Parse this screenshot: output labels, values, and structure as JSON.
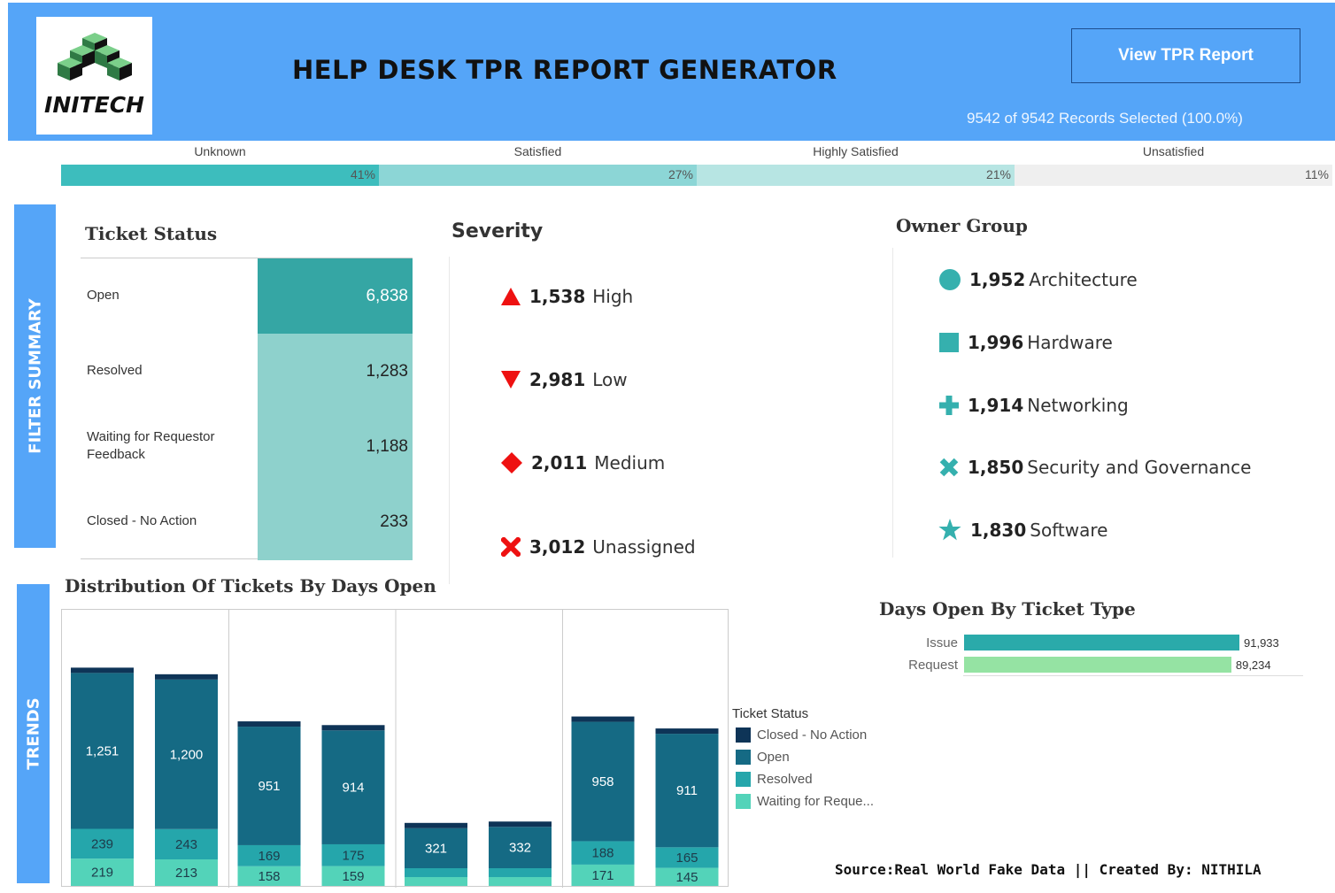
{
  "header": {
    "logo_text": "INITECH",
    "title": "HELP DESK TPR REPORT GENERATOR",
    "button_label": "View TPR Report",
    "records_text": "9542 of 9542 Records Selected (100.0%)",
    "background": "#55a5f8"
  },
  "satisfaction": [
    {
      "label": "Unknown",
      "pct": "41%",
      "color": "#3dbdbd"
    },
    {
      "label": "Satisfied",
      "pct": "27%",
      "color": "#8cd6d6"
    },
    {
      "label": "Highly Satisfied",
      "pct": "21%",
      "color": "#b7e5e3"
    },
    {
      "label": "Unsatisfied",
      "pct": "11%",
      "color": "#efefef"
    }
  ],
  "sidebar_tabs": {
    "filter_summary": "FILTER SUMMARY",
    "trends": "TRENDS"
  },
  "ticket_status": {
    "title": "Ticket Status",
    "rows": [
      {
        "label": "Open",
        "value": "6,838",
        "color": "#35a6a4"
      },
      {
        "label": "Resolved",
        "value": "1,283",
        "color": "#8ed1cc"
      },
      {
        "label": "Waiting for Requestor Feedback",
        "value": "1,188",
        "color": "#8ed1cc"
      },
      {
        "label": "Closed - No Action",
        "value": "233",
        "color": "#8ed1cc"
      }
    ]
  },
  "severity": {
    "title": "Severity",
    "items": [
      {
        "icon": "triangle-up-icon",
        "value": "1,538",
        "label": "High"
      },
      {
        "icon": "triangle-down-icon",
        "value": "2,981",
        "label": "Low"
      },
      {
        "icon": "diamond-icon",
        "value": "2,011",
        "label": "Medium"
      },
      {
        "icon": "x-icon",
        "value": "3,012",
        "label": "Unassigned"
      }
    ],
    "icon_color": "#ee1111"
  },
  "owner_group": {
    "title": "Owner Group",
    "items": [
      {
        "icon": "circle-icon",
        "value": "1,952",
        "label": "Architecture"
      },
      {
        "icon": "square-icon",
        "value": "1,996",
        "label": "Hardware"
      },
      {
        "icon": "plus-icon",
        "value": "1,914",
        "label": "Networking"
      },
      {
        "icon": "x-icon",
        "value": "1,850",
        "label": "Security and Governance"
      },
      {
        "icon": "star-icon",
        "value": "1,830",
        "label": "Software"
      }
    ],
    "icon_color": "#35b0ae"
  },
  "distribution": {
    "title": "Distribution Of Tickets By Days Open",
    "legend_title": "Ticket Status",
    "legend": [
      {
        "label": "Closed - No Action",
        "color": "#0e3457"
      },
      {
        "label": "Open",
        "color": "#156a84"
      },
      {
        "label": "Resolved",
        "color": "#25a6ab"
      },
      {
        "label": "Waiting for Reque...",
        "color": "#53d3b9"
      }
    ]
  },
  "chart_data": {
    "type": "bar",
    "stacked": true,
    "series": [
      {
        "name": "Closed - No Action",
        "values": [
          null,
          null,
          null,
          null,
          null,
          null,
          null,
          null
        ]
      },
      {
        "name": "Open",
        "values": [
          1251,
          1200,
          951,
          914,
          321,
          332,
          958,
          911
        ]
      },
      {
        "name": "Resolved",
        "values": [
          239,
          243,
          169,
          175,
          null,
          null,
          188,
          165
        ]
      },
      {
        "name": "Waiting for Reque...",
        "values": [
          219,
          213,
          158,
          159,
          null,
          null,
          171,
          145
        ]
      }
    ],
    "groups": 4,
    "bars_per_group": 2,
    "grid": false
  },
  "days_open_by_type": {
    "title": "Days Open By Ticket Type",
    "items": [
      {
        "label": "Issue",
        "value": "91,933",
        "num": 91933,
        "color": "#2aaaaa"
      },
      {
        "label": "Request",
        "value": "89,234",
        "num": 89234,
        "color": "#95e3a3"
      }
    ]
  },
  "footer": "Source:Real World Fake Data || Created By: NITHILA"
}
